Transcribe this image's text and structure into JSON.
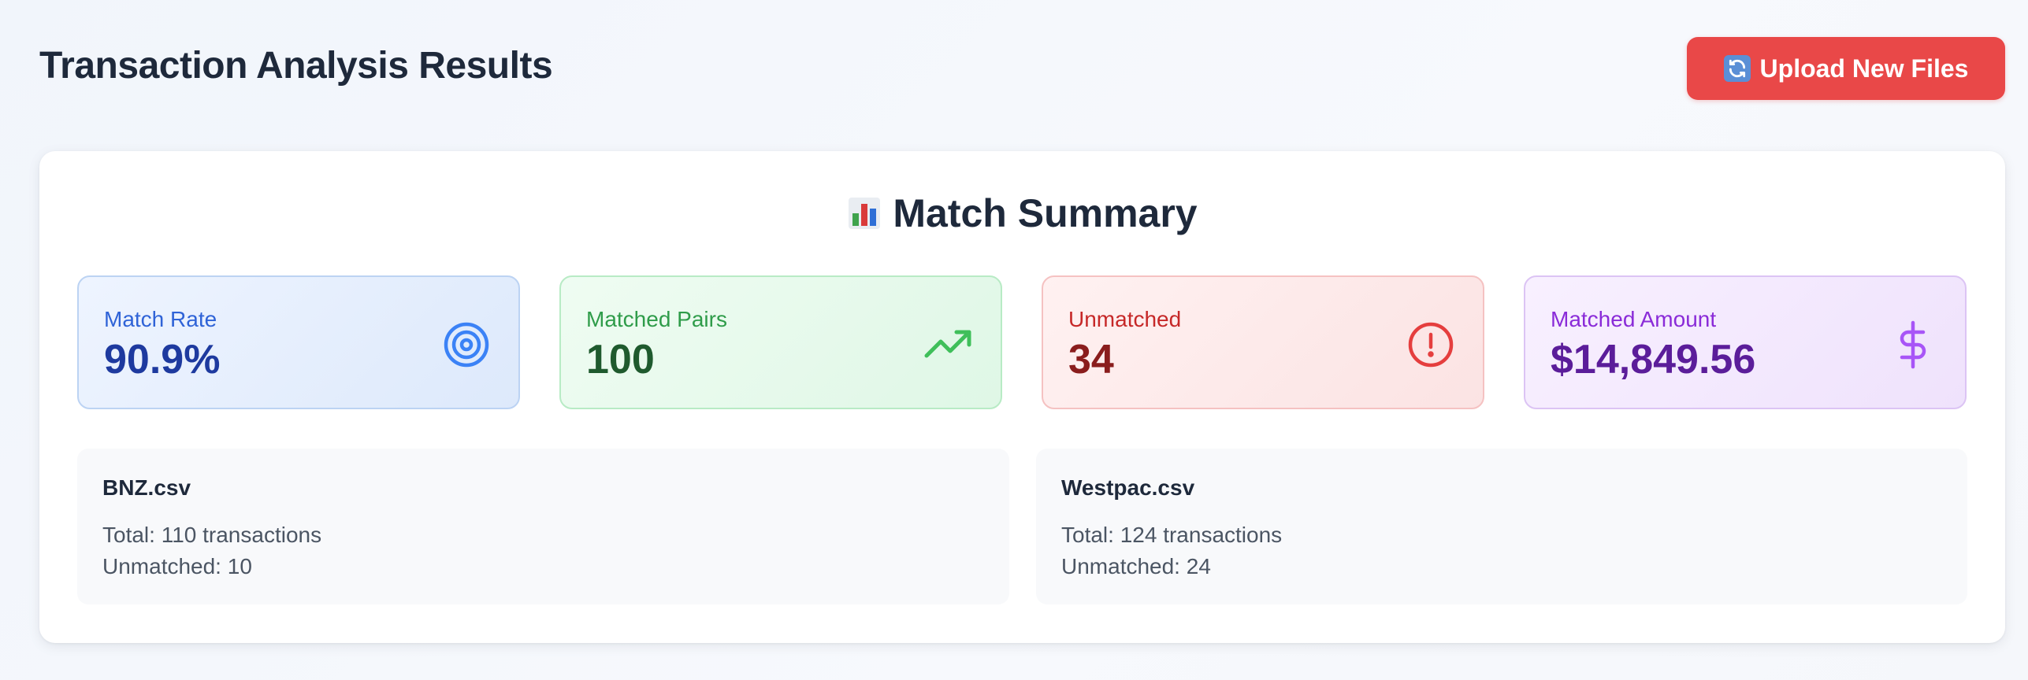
{
  "header": {
    "title": "Transaction Analysis Results",
    "upload_button": "Upload New Files"
  },
  "summary": {
    "title": "Match Summary",
    "stats": [
      {
        "label": "Match Rate",
        "value": "90.9%",
        "icon": "target-icon",
        "color": "#2f63d7"
      },
      {
        "label": "Matched Pairs",
        "value": "100",
        "icon": "trending-up-icon",
        "color": "#2f9c4a"
      },
      {
        "label": "Unmatched",
        "value": "34",
        "icon": "alert-circle-icon",
        "color": "#c62828"
      },
      {
        "label": "Matched Amount",
        "value": "$14,849.56",
        "icon": "dollar-sign-icon",
        "color": "#8a2bd8"
      }
    ],
    "files": [
      {
        "name": "BNZ.csv",
        "total": "Total: 110 transactions",
        "unmatched": "Unmatched: 10"
      },
      {
        "name": "Westpac.csv",
        "total": "Total: 124 transactions",
        "unmatched": "Unmatched: 24"
      }
    ]
  },
  "colors": {
    "accent_red": "#e94848",
    "title": "#1e293b"
  }
}
